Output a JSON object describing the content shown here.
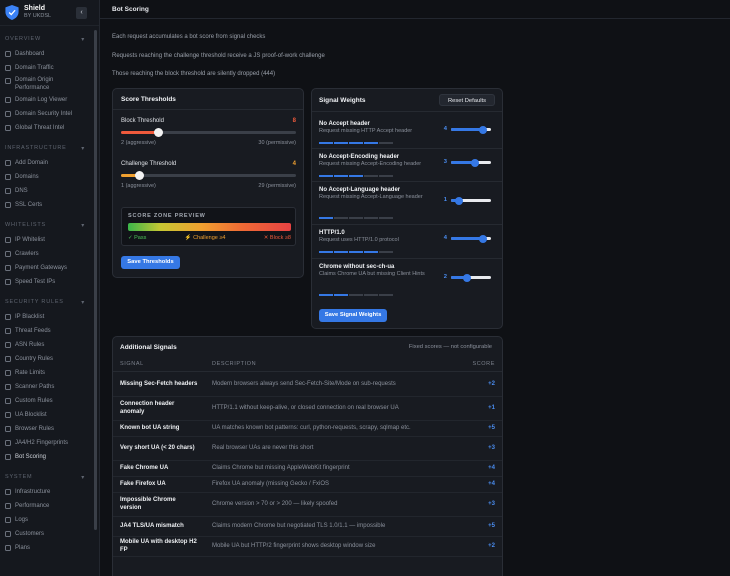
{
  "brand": {
    "name": "Shield",
    "sub": "BY UKDSL",
    "collapse": "‹"
  },
  "sidebar": {
    "sections": [
      {
        "title": "OVERVIEW",
        "items": [
          "Dashboard",
          "Domain Traffic",
          "Domain Origin Performance",
          "Domain Log Viewer",
          "Domain Security Intel",
          "Global Threat Intel"
        ]
      },
      {
        "title": "INFRASTRUCTURE",
        "items": [
          "Add Domain",
          "Domains",
          "DNS",
          "SSL Certs"
        ]
      },
      {
        "title": "WHITELISTS",
        "items": [
          "IP Whitelist",
          "Crawlers",
          "Payment Gateways",
          "Speed Test IPs"
        ]
      },
      {
        "title": "SECURITY RULES",
        "items": [
          "IP Blacklist",
          "Threat Feeds",
          "ASN Rules",
          "Country Rules",
          "Rate Limits",
          "Scanner Paths",
          "Custom Rules",
          "UA Blocklist",
          "Browser Rules",
          "JA4/H2 Fingerprints",
          "Bot Scoring"
        ]
      },
      {
        "title": "SYSTEM",
        "items": [
          "Infrastructure",
          "Performance",
          "Logs",
          "Customers",
          "Plans"
        ]
      }
    ]
  },
  "page": {
    "title": "Bot Scoring",
    "intro": [
      "Each request accumulates a bot score from signal checks",
      "Requests reaching the challenge threshold receive a JS proof-of-work challenge",
      "Those reaching the block threshold are silently dropped (444)"
    ]
  },
  "thresholds": {
    "title": "Score Thresholds",
    "block": {
      "label": "Block Threshold",
      "value": "8",
      "min_label": "2 (aggressive)",
      "max_label": "30 (permissive)",
      "fraction": 0.214
    },
    "challenge": {
      "label": "Challenge Threshold",
      "value": "4",
      "min_label": "1 (aggressive)",
      "max_label": "29 (permissive)",
      "fraction": 0.107
    },
    "preview": {
      "title": "SCORE ZONE PREVIEW",
      "pass": "✓ Pass",
      "challenge": "⚡ Challenge ≥4",
      "block": "✕ Block ≥8"
    },
    "save": "Save Thresholds"
  },
  "weights": {
    "title": "Signal Weights",
    "reset": "Reset Defaults",
    "items": [
      {
        "name": "No Accept header",
        "desc": "Request missing HTTP Accept header",
        "score": "4",
        "fraction": 0.8,
        "segments": 4
      },
      {
        "name": "No Accept-Encoding header",
        "desc": "Request missing Accept-Encoding header",
        "score": "3",
        "fraction": 0.6,
        "segments": 3
      },
      {
        "name": "No Accept-Language header",
        "desc": "Request missing Accept-Language header",
        "score": "1",
        "fraction": 0.2,
        "segments": 1
      },
      {
        "name": "HTTP/1.0",
        "desc": "Request uses HTTP/1.0 protocol",
        "score": "4",
        "fraction": 0.8,
        "segments": 4
      },
      {
        "name": "Chrome without sec-ch-ua",
        "desc": "Claims Chrome UA but missing Client Hints",
        "score": "2",
        "fraction": 0.4,
        "segments": 2
      }
    ],
    "save": "Save Signal Weights"
  },
  "additional": {
    "title": "Additional Signals",
    "note": "Fixed scores — not configurable",
    "headers": {
      "signal": "SIGNAL",
      "description": "DESCRIPTION",
      "score": "SCORE"
    },
    "rows": [
      {
        "signal": "Missing Sec-Fetch headers",
        "description": "Modern browsers always send Sec-Fetch-Site/Mode on sub-requests",
        "score": "+2"
      },
      {
        "signal": "Connection header anomaly",
        "description": "HTTP/1.1 without keep-alive, or closed connection on real browser UA",
        "score": "+1"
      },
      {
        "signal": "Known bot UA string",
        "description": "UA matches known bot patterns: curl, python-requests, scrapy, sqlmap etc.",
        "score": "+5"
      },
      {
        "signal": "Very short UA (< 20 chars)",
        "description": "Real browser UAs are never this short",
        "score": "+3"
      },
      {
        "signal": "Fake Chrome UA",
        "description": "Claims Chrome but missing AppleWebKit fingerprint",
        "score": "+4"
      },
      {
        "signal": "Fake Firefox UA",
        "description": "Firefox UA anomaly (missing Gecko / FxiOS",
        "score": "+4"
      },
      {
        "signal": "Impossible Chrome version",
        "description": "Chrome version > 70 or > 200 — likely spoofed",
        "score": "+3"
      },
      {
        "signal": "JA4 TLS/UA mismatch",
        "description": "Claims modern Chrome but negotiated TLS 1.0/1.1 — impossible",
        "score": "+5"
      },
      {
        "signal": "Mobile UA with desktop H2 FP",
        "description": "Mobile UA but HTTP/2 fingerprint shows desktop window size",
        "score": "+2"
      }
    ]
  },
  "colors": {
    "accent": "#3578e5",
    "block": "#ef5a3c",
    "challenge": "#f0a030",
    "pass": "#3bb54a"
  }
}
